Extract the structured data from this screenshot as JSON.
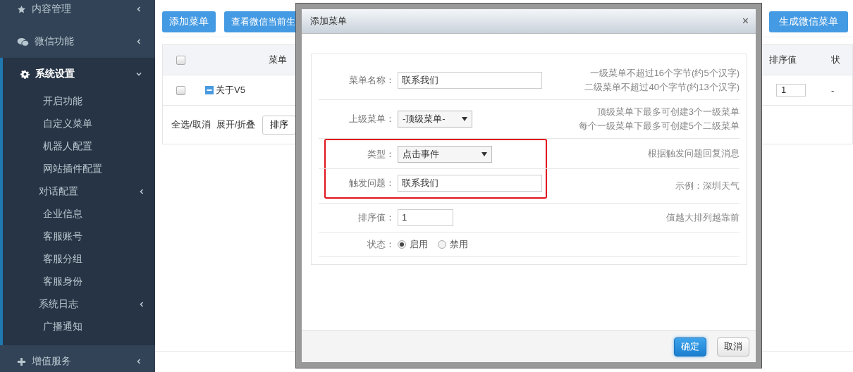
{
  "sidebar": {
    "items": [
      {
        "label": "内容管理",
        "expanded": false
      },
      {
        "label": "微信功能",
        "expanded": false
      },
      {
        "label": "系统设置",
        "expanded": true,
        "children": [
          {
            "label": "开启功能",
            "kind": "link"
          },
          {
            "label": "自定义菜单",
            "kind": "link"
          },
          {
            "label": "机器人配置",
            "kind": "link"
          },
          {
            "label": "网站插件配置",
            "kind": "link"
          },
          {
            "label": "对话配置",
            "kind": "submenu",
            "expanded": false
          },
          {
            "label": "企业信息",
            "kind": "link"
          },
          {
            "label": "客服账号",
            "kind": "link"
          },
          {
            "label": "客服分组",
            "kind": "link"
          },
          {
            "label": "客服身份",
            "kind": "link"
          },
          {
            "label": "系统日志",
            "kind": "submenu",
            "expanded": false
          },
          {
            "label": "广播通知",
            "kind": "link"
          }
        ]
      },
      {
        "label": "增值服务",
        "expanded": false
      }
    ]
  },
  "toolbar": {
    "buttons": [
      "添加菜单",
      "查看微信当前生",
      "生成微信菜单"
    ]
  },
  "table": {
    "header_checked": false,
    "columns": [
      {
        "label": "菜单"
      },
      {
        "label": "排序值"
      },
      {
        "label": "状"
      }
    ],
    "rows": [
      {
        "checked": false,
        "expanded": true,
        "name": "关于V5",
        "sort": "1",
        "status": "-"
      }
    ],
    "footer": {
      "links": [
        "全选/取消",
        "展开/折叠"
      ],
      "button": "排序"
    }
  },
  "dialog": {
    "title": "添加菜单",
    "close": "×",
    "fields": [
      {
        "label": "菜单名称：",
        "kind": "text",
        "value": "联系我们",
        "hint": [
          "一级菜单不超过16个字节(约5个汉字)",
          "二级菜单不超过40个字节(约13个汉字)"
        ],
        "highlighted": false
      },
      {
        "label": "上级菜单：",
        "kind": "select",
        "value": "-顶级菜单-",
        "hint": [
          "顶级菜单下最多可创建3个一级菜单",
          "每个一级菜单下最多可创建5个二级菜单"
        ],
        "highlighted": false
      },
      {
        "label": "类型：",
        "kind": "select",
        "value": "点击事件",
        "hint": [
          "根据触发问题回复消息"
        ],
        "highlighted": true
      },
      {
        "label": "触发问题：",
        "kind": "text",
        "value": "联系我们",
        "hint": [
          "示例：深圳天气"
        ],
        "highlighted": true
      },
      {
        "label": "排序值：",
        "kind": "number",
        "value": "1",
        "hint": [
          "值越大排列越靠前"
        ],
        "highlighted": false
      },
      {
        "label": "状态：",
        "kind": "radio",
        "options": [
          {
            "label": "启用",
            "selected": true
          },
          {
            "label": "禁用",
            "selected": false
          }
        ],
        "highlighted": false
      }
    ],
    "buttons": [
      {
        "label": "确定",
        "kind": "primary"
      },
      {
        "label": "取消",
        "kind": "default"
      }
    ]
  }
}
